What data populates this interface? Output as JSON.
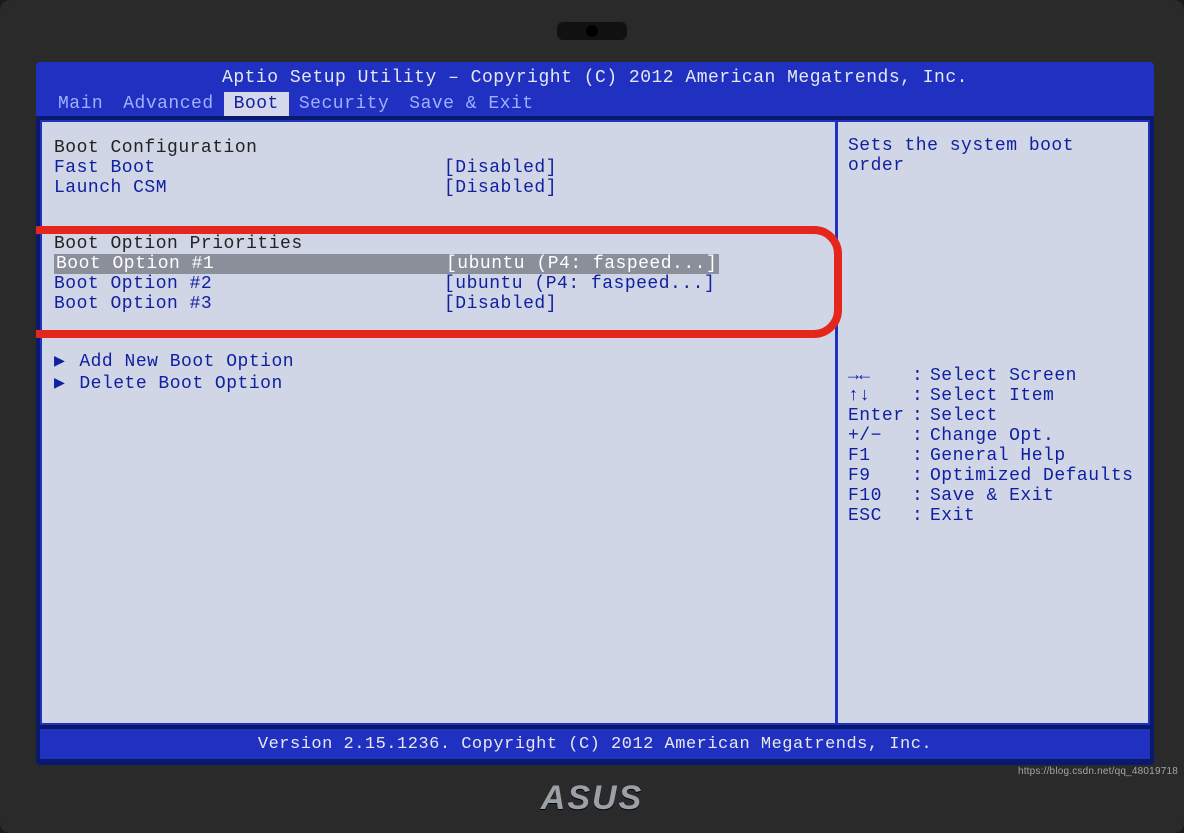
{
  "header": {
    "title": "Aptio Setup Utility – Copyright (C) 2012 American Megatrends, Inc."
  },
  "tabs": [
    "Main",
    "Advanced",
    "Boot",
    "Security",
    "Save & Exit"
  ],
  "active_tab_index": 2,
  "boot_configuration": {
    "heading": "Boot Configuration",
    "items": [
      {
        "label": "Fast Boot",
        "value": "[Disabled]"
      },
      {
        "label": "Launch CSM",
        "value": "[Disabled]"
      }
    ]
  },
  "boot_priorities": {
    "heading": "Boot Option Priorities",
    "items": [
      {
        "label": "Boot Option #1",
        "value": "[ubuntu (P4: faspeed...]",
        "selected": true
      },
      {
        "label": "Boot Option #2",
        "value": "[ubuntu (P4: faspeed...]",
        "selected": false
      },
      {
        "label": "Boot Option #3",
        "value": "[Disabled]",
        "selected": false
      }
    ]
  },
  "boot_actions": [
    {
      "label": "Add New Boot Option"
    },
    {
      "label": "Delete Boot Option"
    }
  ],
  "help": {
    "description": "Sets the system boot order",
    "keys": [
      {
        "key": "→←",
        "desc": "Select Screen"
      },
      {
        "key": "↑↓",
        "desc": "Select Item"
      },
      {
        "key": "Enter",
        "desc": "Select"
      },
      {
        "key": "+/−",
        "desc": "Change Opt."
      },
      {
        "key": "F1",
        "desc": "General Help"
      },
      {
        "key": "F9",
        "desc": "Optimized Defaults"
      },
      {
        "key": "F10",
        "desc": "Save & Exit"
      },
      {
        "key": "ESC",
        "desc": "Exit"
      }
    ]
  },
  "footer": {
    "version": "Version 2.15.1236. Copyright (C) 2012 American Megatrends, Inc."
  },
  "brand": "ASUS",
  "watermark": "https://blog.csdn.net/qq_48019718"
}
